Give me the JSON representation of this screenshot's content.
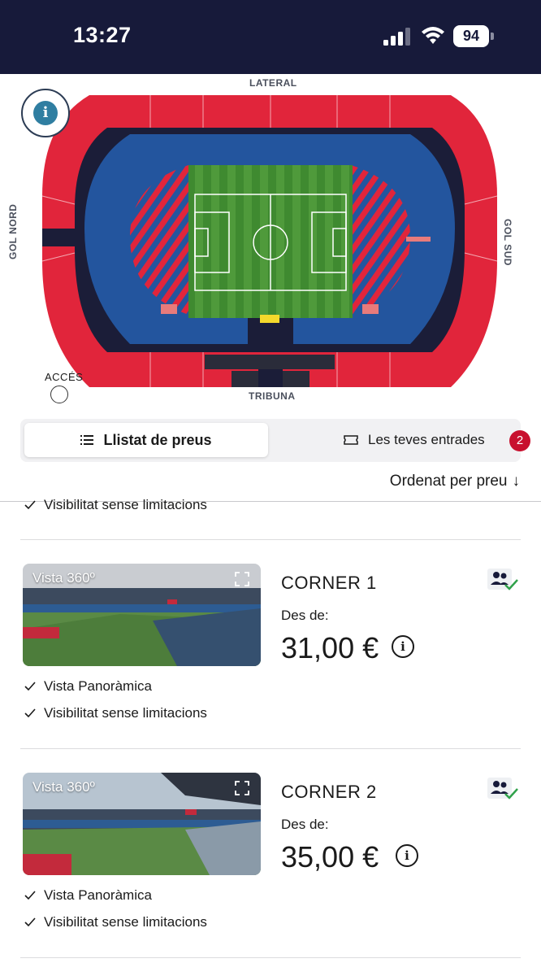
{
  "status_bar": {
    "time": "13:27",
    "battery": "94"
  },
  "map": {
    "info": "i",
    "labels": {
      "lateral": "LATERAL",
      "tribuna": "TRIBUNA",
      "gol_nord": "GOL NORD",
      "gol_sud": "GOL SUD",
      "acces": "ACCÉS"
    },
    "colors": {
      "red": "#e1253b",
      "blue": "#23559e",
      "dark": "#1b1d38",
      "grass": "#4e9a3a"
    }
  },
  "tabs": {
    "active": {
      "label": "Llistat de preus",
      "icon": "list-icon"
    },
    "inactive": {
      "label": "Les teves entrades",
      "icon": "ticket-icon",
      "badge": "2"
    }
  },
  "sort": {
    "label": "Ordenat per preu",
    "arrow": "↓"
  },
  "top_feature": "Visibilitat sense limitacions",
  "seats": [
    {
      "view_label": "Vista 360º",
      "title": "CORNER 1",
      "from_label": "Des de:",
      "price": "31,00 €",
      "features": [
        "Vista Panoràmica",
        "Visibilitat sense limitacions"
      ]
    },
    {
      "view_label": "Vista 360º",
      "title": "CORNER 2",
      "from_label": "Des de:",
      "price": "35,00 €",
      "features": [
        "Vista Panoràmica",
        "Visibilitat sense limitacions"
      ]
    }
  ]
}
